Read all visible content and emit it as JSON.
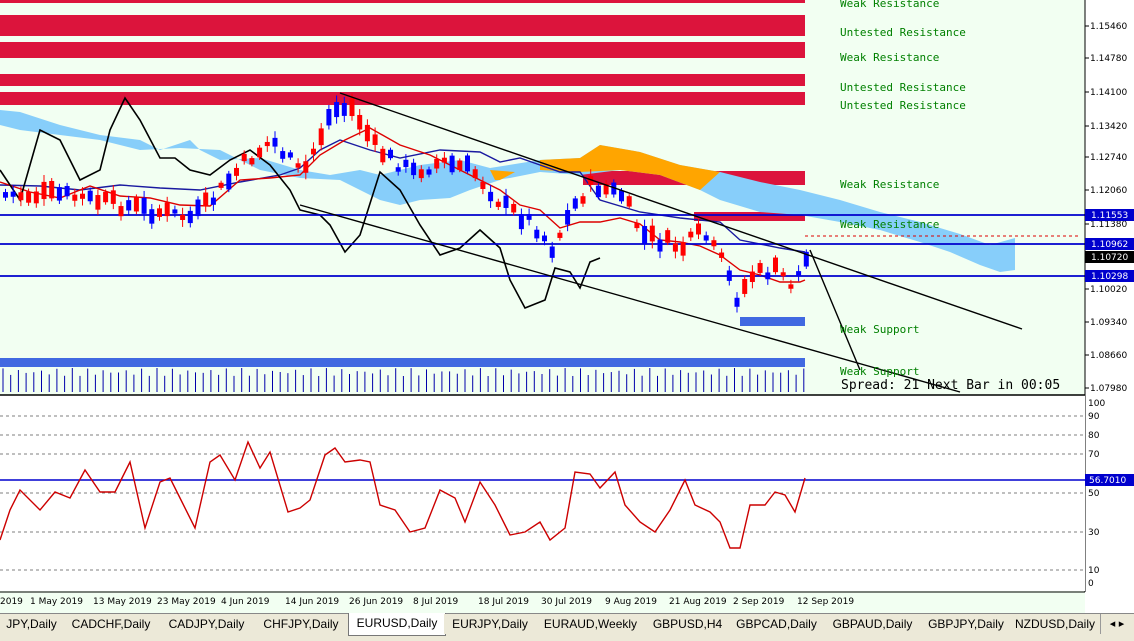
{
  "chart": {
    "zones": [
      {
        "label": "Weak Resistance",
        "type": "resistance"
      },
      {
        "label": "Untested Resistance",
        "type": "resistance"
      },
      {
        "label": "Weak Resistance",
        "type": "resistance"
      },
      {
        "label": "Untested Resistance",
        "type": "resistance"
      },
      {
        "label": "Untested Resistance",
        "type": "resistance"
      },
      {
        "label": "Weak Resistance",
        "type": "resistance"
      },
      {
        "label": "Weak Resistance",
        "type": "resistance"
      },
      {
        "label": "Weak Support",
        "type": "support"
      },
      {
        "label": "Weak Support",
        "type": "support"
      }
    ],
    "status_text": "Spread: 21  Next Bar in 00:05",
    "price_axis": [
      "1.15460",
      "1.14780",
      "1.14100",
      "1.13420",
      "1.12740",
      "1.12060",
      "1.11380",
      "1.10020",
      "1.09340",
      "1.08660",
      "1.07980"
    ],
    "price_tags": [
      {
        "label": "1.11553",
        "style": "blue"
      },
      {
        "label": "1.10962",
        "style": "blue"
      },
      {
        "label": "1.10720",
        "style": "black"
      },
      {
        "label": "1.10298",
        "style": "blue"
      }
    ],
    "rsi_axis": [
      "100",
      "90",
      "80",
      "70",
      "50",
      "30",
      "10",
      "0"
    ],
    "rsi_tag": "56.7010",
    "date_axis": [
      "2019",
      "1 May 2019",
      "13 May 2019",
      "23 May 2019",
      "4 Jun 2019",
      "14 Jun 2019",
      "26 Jun 2019",
      "8 Jul 2019",
      "18 Jul 2019",
      "30 Jul 2019",
      "9 Aug 2019",
      "21 Aug 2019",
      "2 Sep 2019",
      "12 Sep 2019"
    ],
    "colors": {
      "background": "#f2fff2",
      "resistance_zone": "#dc143c",
      "support_zone": "#4169e1",
      "zone_label": "#008000",
      "bull_candle": "#0000ff",
      "bear_candle": "#ff0000",
      "kumo_bull": "#87cefa",
      "kumo_bear": "#ffa500",
      "rsi_line": "#cc0000",
      "level_line": "#0000cd"
    }
  },
  "tabs": [
    "JPY,Daily",
    "CADCHF,Daily",
    "CADJPY,Daily",
    "CHFJPY,Daily",
    "EURUSD,Daily",
    "EURJPY,Daily",
    "EURAUD,Weekly",
    "GBPUSD,H4",
    "GBPCAD,Daily",
    "GBPAUD,Daily",
    "GBPJPY,Daily",
    "NZDUSD,Daily"
  ],
  "active_tab": "EURUSD,Daily",
  "tab_scroll": "◂ ▸"
}
